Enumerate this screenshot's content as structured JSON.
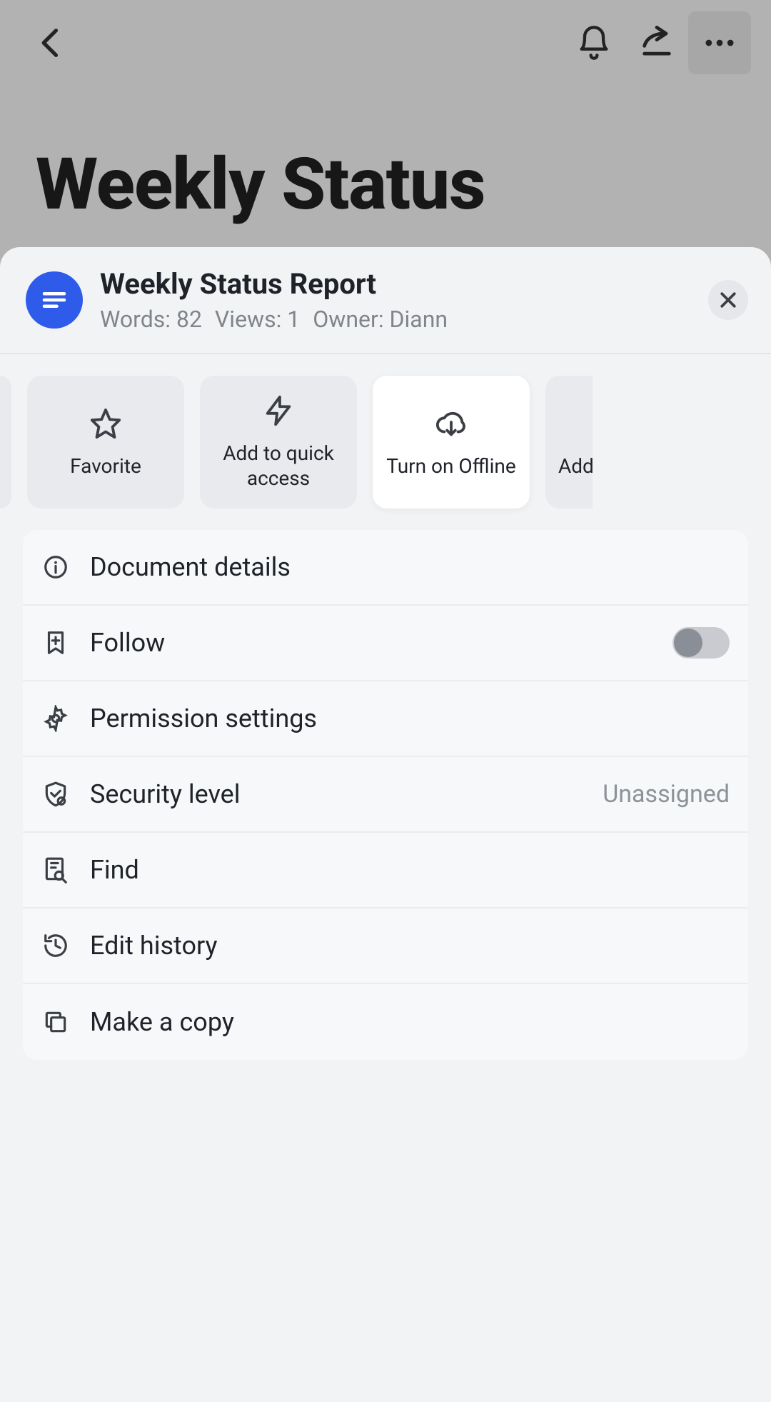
{
  "background": {
    "title": "Weekly Status"
  },
  "sheet": {
    "title": "Weekly Status Report",
    "meta": {
      "words_label": "Words: 82",
      "views_label": "Views: 1",
      "owner_label": "Owner: Diann"
    },
    "tiles": {
      "favorite": "Favorite",
      "quick": "Add to quick access",
      "offline": "Turn on Offline",
      "partial_right": "Add"
    },
    "menu": {
      "details": "Document details",
      "follow": "Follow",
      "permissions": "Permission settings",
      "security": "Security level",
      "security_value": "Unassigned",
      "find": "Find",
      "history": "Edit history",
      "copy": "Make a copy"
    }
  }
}
